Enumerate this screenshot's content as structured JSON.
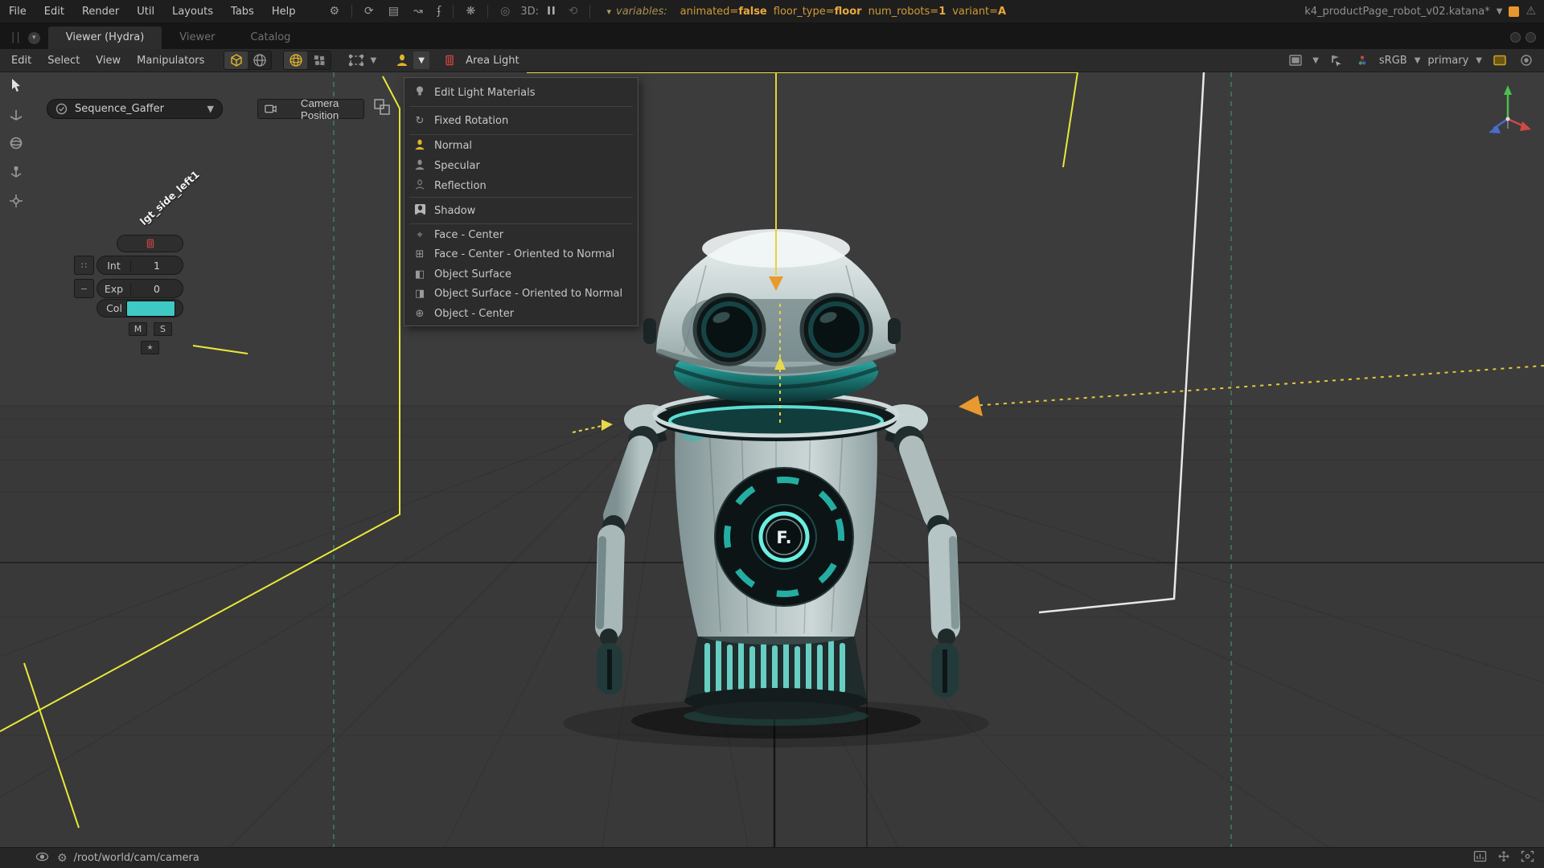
{
  "menubar": {
    "items": [
      "File",
      "Edit",
      "Render",
      "Util",
      "Layouts",
      "Tabs",
      "Help"
    ],
    "threeD_label": "3D:",
    "pause_label": "II",
    "variables": {
      "caret": "▾",
      "label": "variables:",
      "pairs": [
        {
          "key": "animated=",
          "value": "false"
        },
        {
          "key": "floor_type=",
          "value": "floor"
        },
        {
          "key": "num_robots=",
          "value": "1"
        },
        {
          "key": "variant=",
          "value": "A"
        }
      ]
    },
    "document_title": "k4_productPage_robot_v02.katana*",
    "title_caret": "▼",
    "warning_glyph": "⚠"
  },
  "glyphs": {
    "gear": "⚙",
    "recycle": "⟳",
    "clapper": "▤",
    "curve": "↝",
    "hook": "ʄ",
    "flask": "❋",
    "render_dot": "◎",
    "refresh": "⟲",
    "caret_down": "▾",
    "caret_down_big": "▼",
    "handle": "∷",
    "minus": "−",
    "star": "★",
    "bulb": "⚲",
    "rotation": "↻",
    "face_center": "⌖",
    "face_center_normal": "⊞",
    "object_surface": "◧",
    "object_surface_normal": "◨",
    "object_center": "⊕"
  },
  "tabs": [
    {
      "label": "Viewer (Hydra)",
      "active": true
    },
    {
      "label": "Viewer",
      "active": false
    },
    {
      "label": "Catalog",
      "active": false
    }
  ],
  "viewer_toolbar": {
    "menus": [
      "Edit",
      "Select",
      "View",
      "Manipulators"
    ],
    "current_light_type": "Area Light",
    "colorspace": "sRGB",
    "channel": "primary"
  },
  "dropdown": {
    "items": [
      {
        "label": "Edit Light Materials"
      },
      {
        "label": "Fixed Rotation"
      },
      {
        "label": "Normal",
        "selected": true
      },
      {
        "label": "Specular"
      },
      {
        "label": "Reflection"
      },
      {
        "label": "Shadow"
      },
      {
        "label": "Face - Center"
      },
      {
        "label": "Face - Center - Oriented to Normal"
      },
      {
        "label": "Object Surface"
      },
      {
        "label": "Object Surface - Oriented to Normal"
      },
      {
        "label": "Object - Center"
      }
    ]
  },
  "gaffer": {
    "selector_label": "Sequence_Gaffer",
    "camera_button_label": "Camera Position",
    "light_name": "lgt_side_left1",
    "int_label": "Int",
    "int_value": "1",
    "exp_label": "Exp",
    "exp_value": "0",
    "col_label": "Col",
    "col_style": "background:#3ec9c4",
    "mute_label": "M",
    "solo_label": "S"
  },
  "robot": {
    "emblem_text": "F."
  },
  "statusbar": {
    "path": "/root/world/cam/camera"
  },
  "colors": {
    "accent_yellow": "#e3b528",
    "area_light_red": "#cc4444",
    "swatch_cyan": "#3ec9c4",
    "frame_yellow": "#e8e83a",
    "frame_white": "#eeeeee",
    "dash_green": "#3f8a5f",
    "arrow_orange": "#e89a2e",
    "variables_orange": "#eaa93c"
  }
}
